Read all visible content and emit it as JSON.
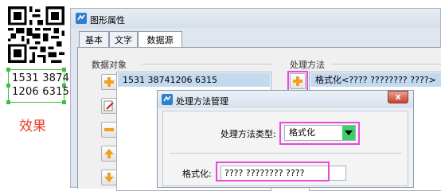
{
  "preview": {
    "barcode_lines": [
      "1531 3874",
      "1206 6315"
    ],
    "caption": "效果"
  },
  "window": {
    "title": "图形属性",
    "tabs": [
      {
        "label": "基本",
        "active": false
      },
      {
        "label": "文字",
        "active": false
      },
      {
        "label": "数据源",
        "active": true
      }
    ],
    "data_objects": {
      "group_label": "数据对象",
      "items": [
        "1531 38741206 6315"
      ]
    },
    "processing": {
      "group_label": "处理方法",
      "items": [
        "格式化<???? ???????? ????>"
      ]
    }
  },
  "dialog": {
    "title": "处理方法管理",
    "close_label": "x",
    "type_label": "处理方法类型:",
    "type_value": "格式化",
    "format_label": "格式化:",
    "format_value": "???? ???????? ????"
  },
  "colors": {
    "highlight": "#e64ad8",
    "label_border": "#3fbf3f",
    "caption": "#e8412c",
    "combo_button": "#3ccf6a",
    "selection": "#c3d9f0"
  }
}
